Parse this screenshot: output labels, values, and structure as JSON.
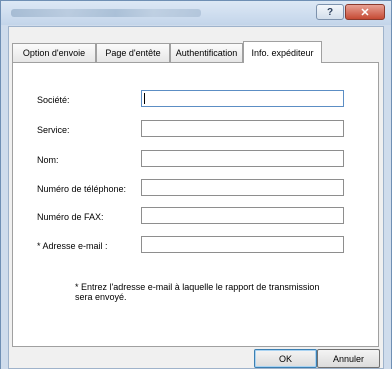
{
  "titlebar": {
    "help_label": "?",
    "close_label": "✕"
  },
  "tabs": [
    {
      "label": "Option d'envoie"
    },
    {
      "label": "Page d'entête"
    },
    {
      "label": "Authentification"
    },
    {
      "label": "Info. expéditeur"
    }
  ],
  "form": {
    "fields": [
      {
        "label": "Société:",
        "value": ""
      },
      {
        "label": "Service:",
        "value": ""
      },
      {
        "label": "Nom:",
        "value": ""
      },
      {
        "label": "Numéro de téléphone:",
        "value": ""
      },
      {
        "label": "Numéro de FAX:",
        "value": ""
      },
      {
        "label": "* Adresse e-mail :",
        "value": ""
      }
    ],
    "note": "* Entrez l'adresse e-mail à laquelle le rapport de transmission sera envoyé."
  },
  "buttons": {
    "ok": "OK",
    "cancel": "Annuler"
  },
  "colors": {
    "titlebar": "#c3d5ea",
    "close_button": "#c54a34",
    "frame": "#cfdcec"
  }
}
